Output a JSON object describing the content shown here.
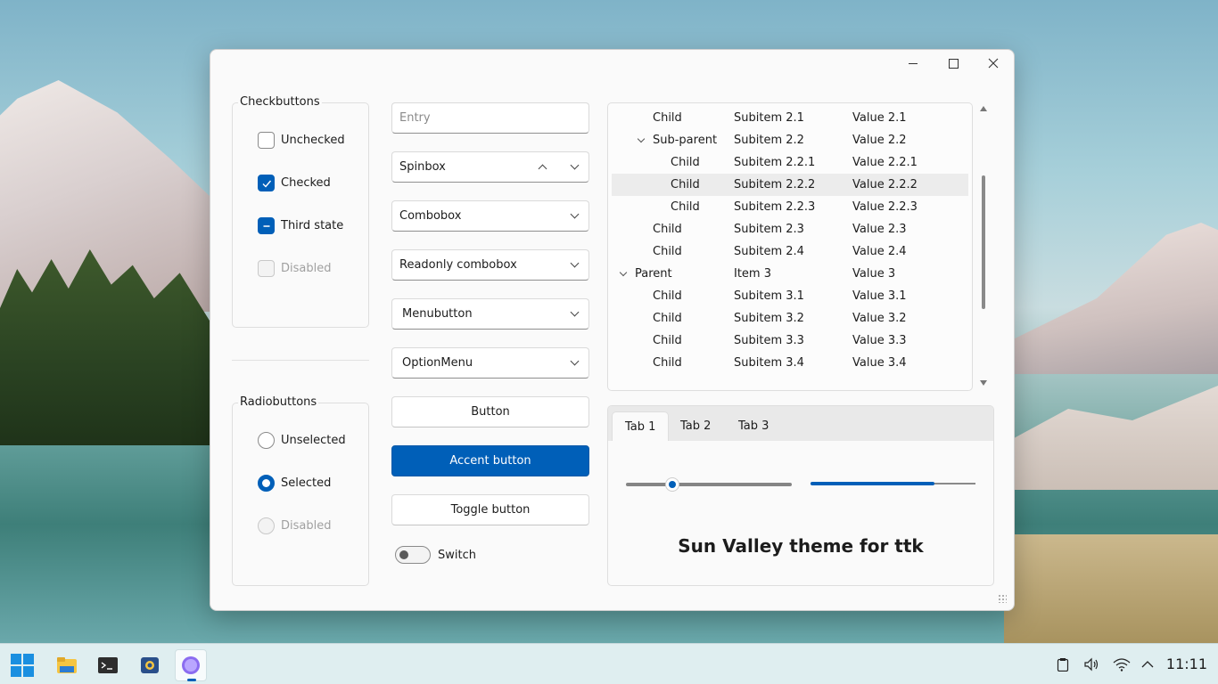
{
  "checkbuttons": {
    "title": "Checkbuttons",
    "items": [
      {
        "label": "Unchecked",
        "state": "unchecked"
      },
      {
        "label": "Checked",
        "state": "checked"
      },
      {
        "label": "Third state",
        "state": "indeterminate"
      },
      {
        "label": "Disabled",
        "state": "disabled"
      }
    ]
  },
  "radiobuttons": {
    "title": "Radiobuttons",
    "items": [
      {
        "label": "Unselected",
        "state": "unselected"
      },
      {
        "label": "Selected",
        "state": "selected"
      },
      {
        "label": "Disabled",
        "state": "disabled"
      }
    ]
  },
  "widgets": {
    "entry_placeholder": "Entry",
    "spinbox": "Spinbox",
    "combobox": "Combobox",
    "readonly_combobox": "Readonly combobox",
    "menubutton": "Menubutton",
    "optionmenu": "OptionMenu",
    "button": "Button",
    "accent_button": "Accent button",
    "toggle_button": "Toggle button",
    "switch": "Switch"
  },
  "tree": {
    "rows": [
      {
        "name": "Child",
        "item": "Subitem 2.1",
        "value": "Value 2.1"
      },
      {
        "name": "Sub-parent",
        "item": "Subitem 2.2",
        "value": "Value 2.2"
      },
      {
        "name": "Child",
        "item": "Subitem 2.2.1",
        "value": "Value 2.2.1"
      },
      {
        "name": "Child",
        "item": "Subitem 2.2.2",
        "value": "Value 2.2.2"
      },
      {
        "name": "Child",
        "item": "Subitem 2.2.3",
        "value": "Value 2.2.3"
      },
      {
        "name": "Child",
        "item": "Subitem 2.3",
        "value": "Value 2.3"
      },
      {
        "name": "Child",
        "item": "Subitem 2.4",
        "value": "Value 2.4"
      },
      {
        "name": "Parent",
        "item": "Item 3",
        "value": "Value 3"
      },
      {
        "name": "Child",
        "item": "Subitem 3.1",
        "value": "Value 3.1"
      },
      {
        "name": "Child",
        "item": "Subitem 3.2",
        "value": "Value 3.2"
      },
      {
        "name": "Child",
        "item": "Subitem 3.3",
        "value": "Value 3.3"
      },
      {
        "name": "Child",
        "item": "Subitem 3.4",
        "value": "Value 3.4"
      }
    ],
    "selected_index": 3
  },
  "notebook": {
    "tabs": [
      "Tab 1",
      "Tab 2",
      "Tab 3"
    ],
    "active_tab": 0,
    "scale_value": 0.28,
    "progress_value": 0.75,
    "label": "Sun Valley theme for ttk"
  },
  "taskbar": {
    "clock": "11:11",
    "apps": [
      "start-icon",
      "file-explorer-icon",
      "terminal-icon",
      "python-idle-icon",
      "app-circle-icon"
    ]
  },
  "colors": {
    "accent": "#005fb8"
  }
}
